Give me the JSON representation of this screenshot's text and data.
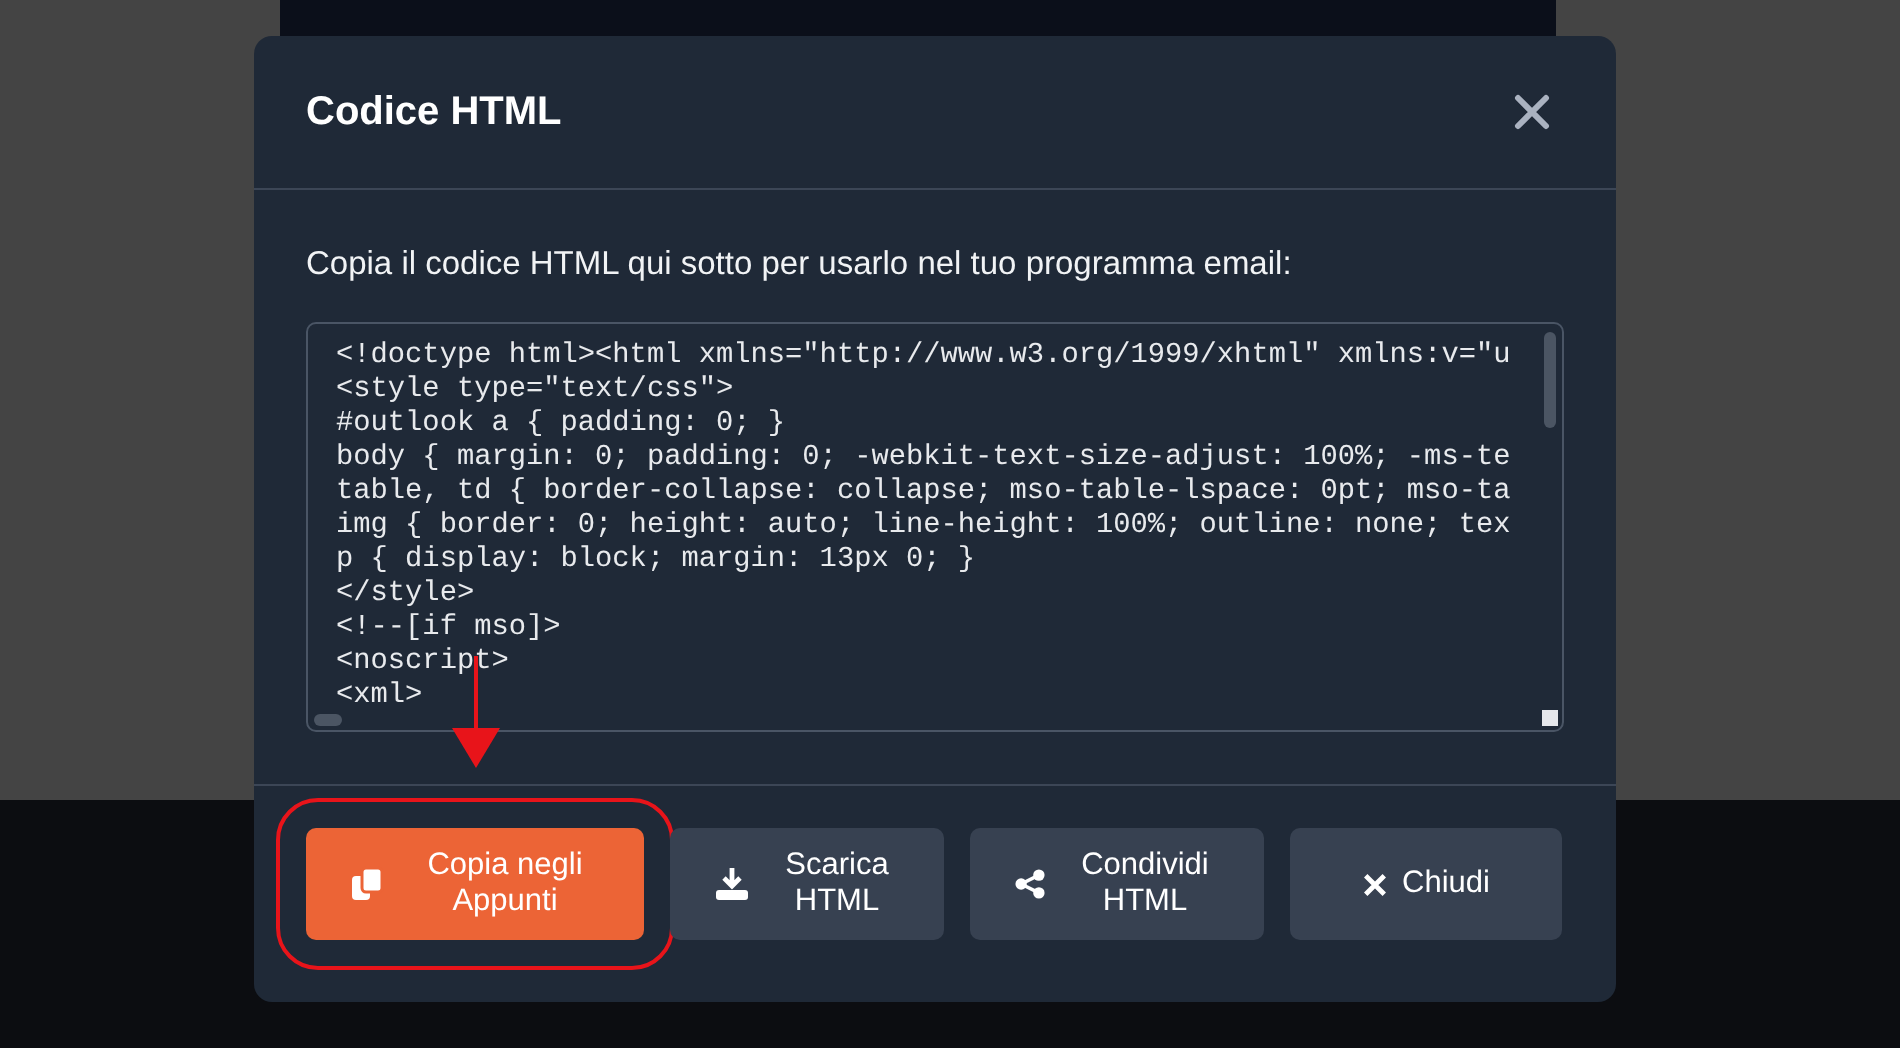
{
  "dialog": {
    "title": "Codice HTML",
    "instruction": "Copia il codice HTML qui sotto per usarlo nel tuo programma email:",
    "code_lines": [
      "<!doctype html><html xmlns=\"http://www.w3.org/1999/xhtml\" xmlns:v=\"u",
      "<style type=\"text/css\">",
      "#outlook a { padding: 0; }",
      "body { margin: 0; padding: 0; -webkit-text-size-adjust: 100%; -ms-te",
      "table, td { border-collapse: collapse; mso-table-lspace: 0pt; mso-ta",
      "img { border: 0; height: auto; line-height: 100%; outline: none; tex",
      "p { display: block; margin: 13px 0; }",
      "</style>",
      "<!--[if mso]>",
      "<noscript>",
      "<xml>"
    ],
    "buttons": [
      {
        "label": "Copia negli Appunti",
        "kind": "primary",
        "highlighted": true
      },
      {
        "label": "Scarica HTML",
        "kind": "secondary",
        "highlighted": false
      },
      {
        "label": "Condividi HTML",
        "kind": "secondary",
        "highlighted": false
      },
      {
        "label": "Chiudi",
        "kind": "secondary",
        "highlighted": false
      }
    ]
  }
}
